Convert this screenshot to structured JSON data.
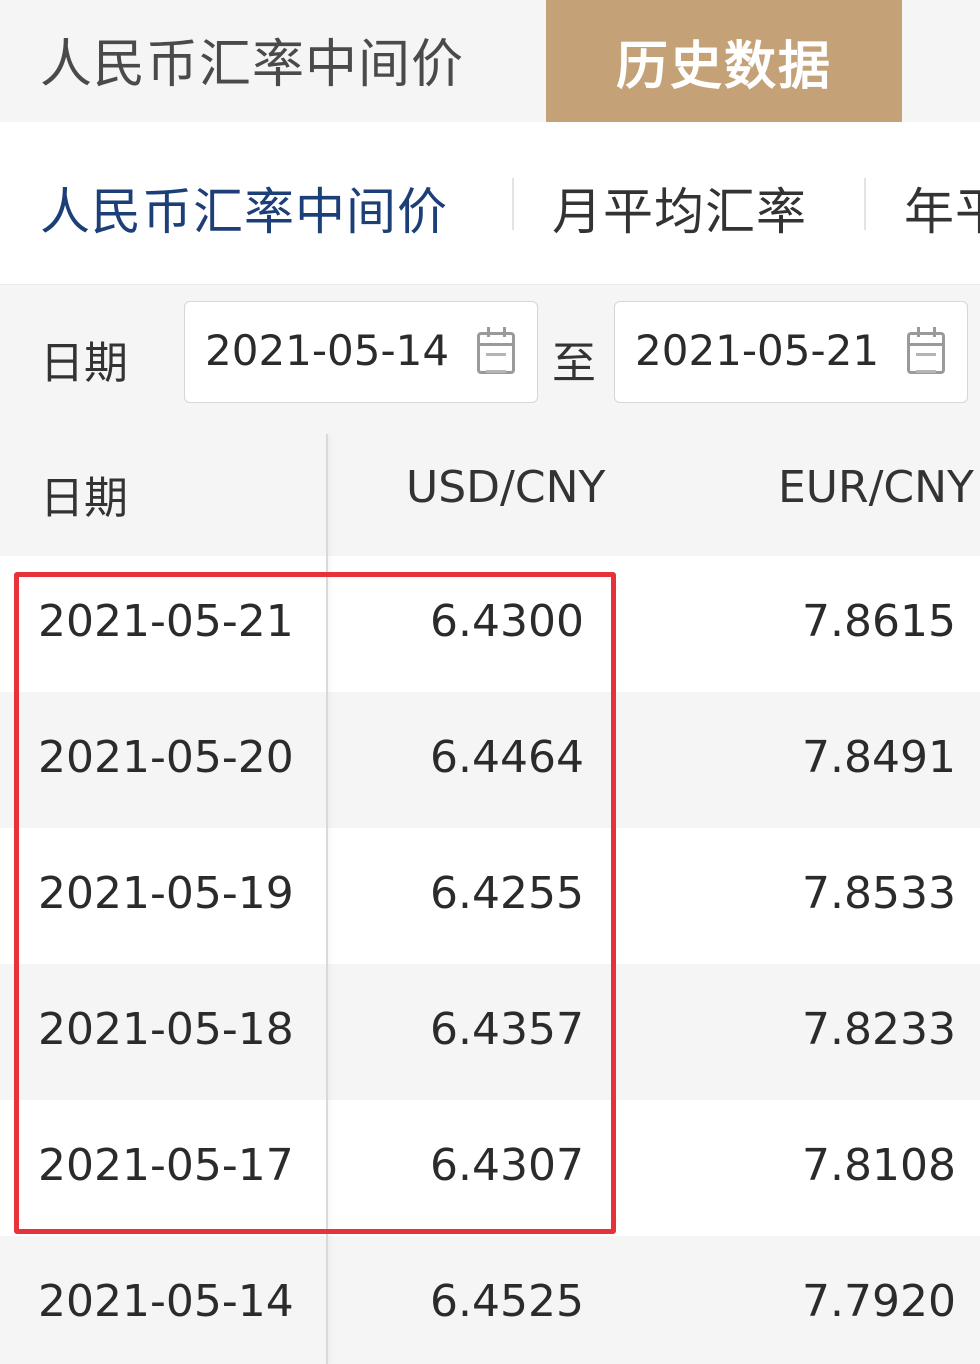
{
  "header": {
    "title": "人民币汇率中间价",
    "active_tab": "历史数据"
  },
  "subnav": {
    "items": [
      "人民币汇率中间价",
      "月平均汇率",
      "年平"
    ],
    "active_index": 0
  },
  "filter": {
    "date_label": "日期",
    "start_date": "2021-05-14",
    "to_label": "至",
    "end_date": "2021-05-21"
  },
  "table": {
    "headers": [
      "日期",
      "USD/CNY",
      "EUR/CNY"
    ],
    "rows": [
      {
        "date": "2021-05-21",
        "usd": "6.4300",
        "eur": "7.8615"
      },
      {
        "date": "2021-05-20",
        "usd": "6.4464",
        "eur": "7.8491"
      },
      {
        "date": "2021-05-19",
        "usd": "6.4255",
        "eur": "7.8533"
      },
      {
        "date": "2021-05-18",
        "usd": "6.4357",
        "eur": "7.8233"
      },
      {
        "date": "2021-05-17",
        "usd": "6.4307",
        "eur": "7.8108"
      },
      {
        "date": "2021-05-14",
        "usd": "6.4525",
        "eur": "7.7920"
      }
    ]
  },
  "colors": {
    "accent_tab": "#c4a177",
    "active_nav": "#1d3f78",
    "highlight": "#e8323a"
  },
  "icons": {
    "date_picker": "calendar-icon"
  }
}
